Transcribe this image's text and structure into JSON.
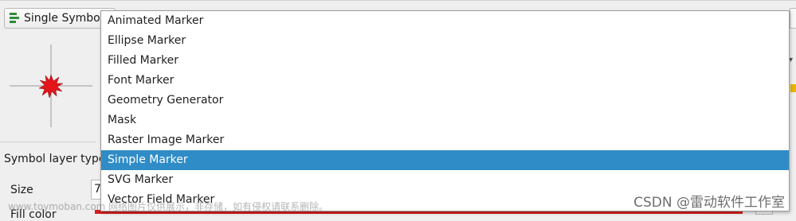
{
  "renderer": {
    "label": "Single Symbol",
    "icon": "single-symbol-icon"
  },
  "symbol_layer_type_label": "Symbol layer type",
  "size": {
    "label": "Size",
    "value": "7"
  },
  "fill_label": "Fill color",
  "dropdown": {
    "items": [
      "Animated Marker",
      "Ellipse Marker",
      "Filled Marker",
      "Font Marker",
      "Geometry Generator",
      "Mask",
      "Raster Image Marker",
      "Simple Marker",
      "SVG Marker",
      "Vector Field Marker"
    ],
    "selected": "Simple Marker"
  },
  "watermarks": {
    "left": "www.toymoban.com 网络图片仅供展示，非存储，如有侵权请联系删除。",
    "right": "CSDN @雷动软件工作室"
  },
  "colors": {
    "selection": "#308cc6",
    "marker": "#e3141b",
    "accent_bar": "#d91c1c"
  }
}
